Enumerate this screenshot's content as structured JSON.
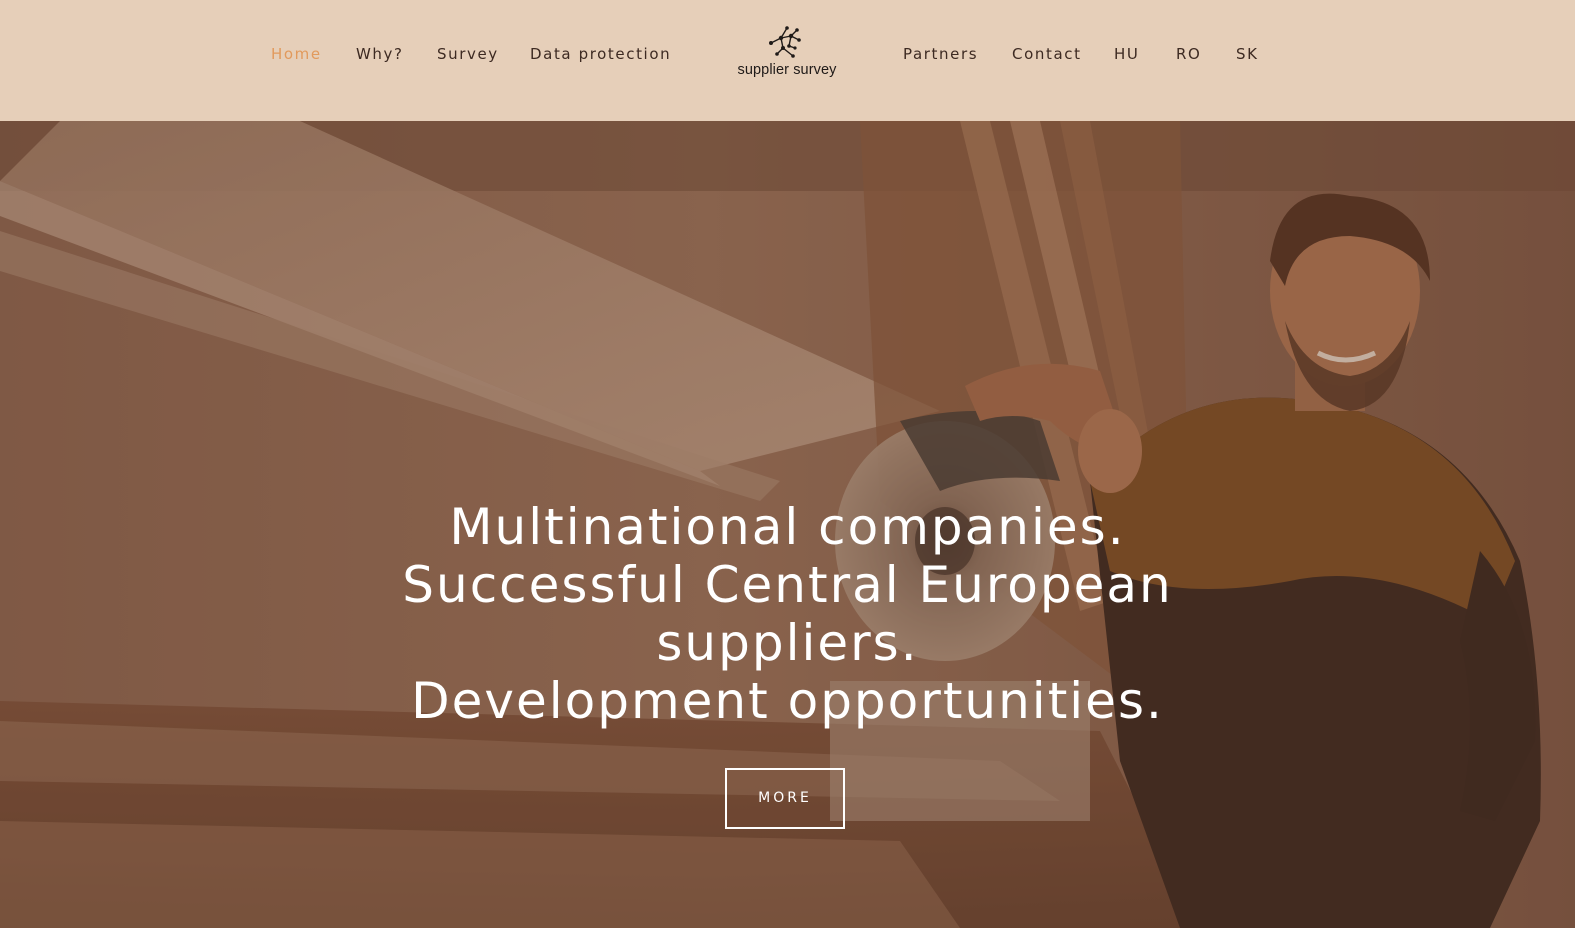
{
  "nav": {
    "left_items": [
      {
        "label": "Home",
        "active": true
      },
      {
        "label": "Why?",
        "active": false
      },
      {
        "label": "Survey",
        "active": false
      },
      {
        "label": "Data protection",
        "active": false
      }
    ],
    "right_items": [
      {
        "label": "Partners"
      },
      {
        "label": "Contact"
      },
      {
        "label": "HU"
      },
      {
        "label": "RO"
      },
      {
        "label": "SK"
      }
    ]
  },
  "logo": {
    "text": "supplier survey",
    "icon": "network-nodes-icon"
  },
  "hero": {
    "title_lines": [
      "Multinational companies.",
      "Successful Central European",
      "suppliers.",
      "Development opportunities."
    ],
    "button_label": "MORE",
    "image": "carpenter-workshop-photo"
  },
  "colors": {
    "nav_background": "#e6cfb9",
    "active_link": "#e29a5c",
    "link": "#3d2a22",
    "hero_overlay": "#6b4632"
  }
}
